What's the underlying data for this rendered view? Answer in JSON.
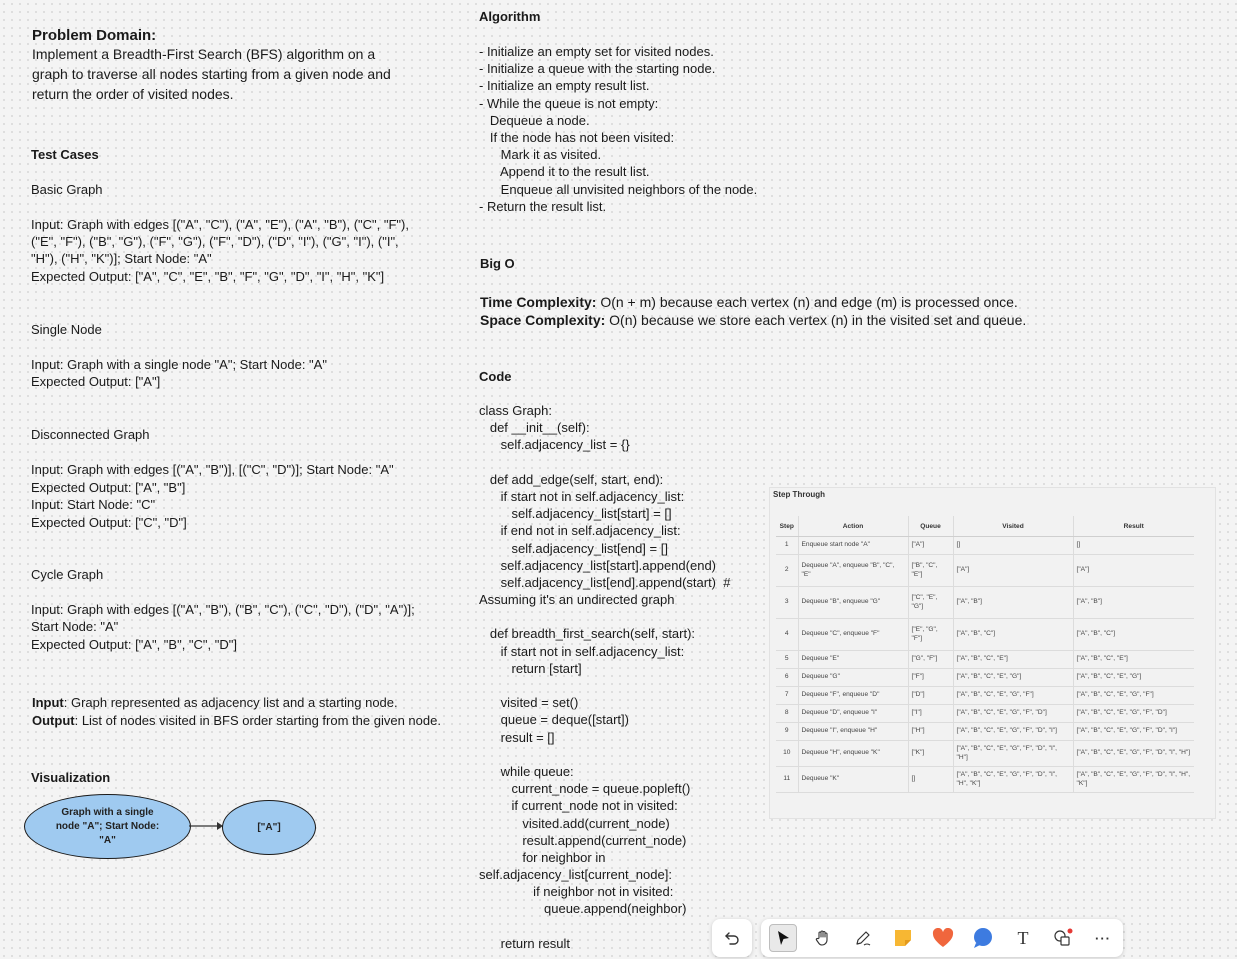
{
  "problem_domain": {
    "heading": "Problem Domain:",
    "text": "Implement a Breadth-First Search (BFS) algorithm on a graph to traverse all nodes starting from a given node and return the order of visited nodes."
  },
  "test_cases": {
    "heading": "Test Cases",
    "basic": {
      "title": "Basic Graph",
      "input": "Input: Graph with edges [(\"A\", \"C\"), (\"A\", \"E\"), (\"A\", \"B\"), (\"C\", \"F\"), (\"E\", \"F\"), (\"B\", \"G\"), (\"F\", \"G\"), (\"F\", \"D\"), (\"D\", \"I\"), (\"G\", \"I\"), (\"I\", \"H\"), (\"H\", \"K\")]; Start Node: \"A\"",
      "output": "Expected Output: [\"A\", \"C\", \"E\", \"B\", \"F\", \"G\", \"D\", \"I\", \"H\", \"K\"]"
    },
    "single": {
      "title": "Single Node",
      "input": "Input: Graph with a single node \"A\"; Start Node: \"A\"",
      "output": "Expected Output: [\"A\"]"
    },
    "disconnected": {
      "title": "Disconnected Graph",
      "input": "Input: Graph with edges [(\"A\", \"B\")], [(\"C\", \"D\")]; Start Node: \"A\"",
      "output": "Expected Output: [\"A\", \"B\"]",
      "input2": "Input: Start Node: \"C\"",
      "output2": "Expected Output: [\"C\", \"D\"]"
    },
    "cycle": {
      "title": "Cycle Graph",
      "input": "Input: Graph with edges [(\"A\", \"B\"), (\"B\", \"C\"), (\"C\", \"D\"), (\"D\", \"A\")]; Start Node: \"A\"",
      "output": "Expected Output: [\"A\", \"B\", \"C\", \"D\"]"
    }
  },
  "io": {
    "input_label": "Input",
    "input_text": ": Graph represented as adjacency list and a starting node.",
    "output_label": "Output",
    "output_text": ": List of nodes visited in BFS order starting from the given node."
  },
  "visualization": {
    "heading": "Visualization",
    "node1": "Graph with a single node \"A\"; Start Node: \"A\"",
    "node2": "[\"A\"]"
  },
  "algorithm": {
    "heading": "Algorithm",
    "lines": [
      "- Initialize an empty set for visited nodes.",
      "- Initialize a queue with the starting node.",
      "- Initialize an empty result list.",
      "- While the queue is not empty:",
      "   Dequeue a node.",
      "   If the node has not been visited:",
      "      Mark it as visited.",
      "      Append it to the result list.",
      "      Enqueue all unvisited neighbors of the node.",
      "- Return the result list."
    ]
  },
  "big_o": {
    "heading": "Big O",
    "time_label": "Time Complexity:",
    "time_text": " O(n + m) because each vertex (n) and edge (m) is processed once.",
    "space_label": "Space Complexity:",
    "space_text": " O(n) because we store each vertex (n) in the visited set and queue."
  },
  "code": {
    "heading": "Code",
    "lines": [
      "class Graph:",
      "   def __init__(self):",
      "      self.adjacency_list = {}",
      "",
      "   def add_edge(self, start, end):",
      "      if start not in self.adjacency_list:",
      "         self.adjacency_list[start] = []",
      "      if end not in self.adjacency_list:",
      "         self.adjacency_list[end] = []",
      "      self.adjacency_list[start].append(end)",
      "      self.adjacency_list[end].append(start)  #",
      "Assuming it's an undirected graph",
      "",
      "   def breadth_first_search(self, start):",
      "      if start not in self.adjacency_list:",
      "         return [start]",
      "",
      "      visited = set()",
      "      queue = deque([start])",
      "      result = []",
      "",
      "      while queue:",
      "         current_node = queue.popleft()",
      "         if current_node not in visited:",
      "            visited.add(current_node)",
      "            result.append(current_node)",
      "            for neighbor in",
      "self.adjacency_list[current_node]:",
      "               if neighbor not in visited:",
      "                  queue.append(neighbor)",
      "",
      "      return result"
    ]
  },
  "step_through": {
    "title": "Step Through",
    "headers": [
      "Step",
      "Action",
      "Queue",
      "Visited",
      "Result"
    ],
    "rows": [
      [
        "1",
        "Enqueue start node \"A\"",
        "[\"A\"]",
        "[]",
        "[]"
      ],
      [
        "2",
        "Dequeue \"A\", enqueue \"B\", \"C\", \"E\"",
        "[\"B\", \"C\", \"E\"]",
        "[\"A\"]",
        "[\"A\"]"
      ],
      [
        "3",
        "Dequeue \"B\", enqueue \"G\"",
        "[\"C\", \"E\", \"G\"]",
        "[\"A\", \"B\"]",
        "[\"A\", \"B\"]"
      ],
      [
        "4",
        "Dequeue \"C\", enqueue \"F\"",
        "[\"E\", \"G\", \"F\"]",
        "[\"A\", \"B\", \"C\"]",
        "[\"A\", \"B\", \"C\"]"
      ],
      [
        "5",
        "Dequeue \"E\"",
        "[\"G\", \"F\"]",
        "[\"A\", \"B\", \"C\", \"E\"]",
        "[\"A\", \"B\", \"C\", \"E\"]"
      ],
      [
        "6",
        "Dequeue \"G\"",
        "[\"F\"]",
        "[\"A\", \"B\", \"C\", \"E\", \"G\"]",
        "[\"A\", \"B\", \"C\", \"E\", \"G\"]"
      ],
      [
        "7",
        "Dequeue \"F\", enqueue \"D\"",
        "[\"D\"]",
        "[\"A\", \"B\", \"C\", \"E\", \"G\", \"F\"]",
        "[\"A\", \"B\", \"C\", \"E\", \"G\", \"F\"]"
      ],
      [
        "8",
        "Dequeue \"D\", enqueue \"I\"",
        "[\"I\"]",
        "[\"A\", \"B\", \"C\", \"E\", \"G\", \"F\", \"D\"]",
        "[\"A\", \"B\", \"C\", \"E\", \"G\", \"F\", \"D\"]"
      ],
      [
        "9",
        "Dequeue \"I\", enqueue \"H\"",
        "[\"H\"]",
        "[\"A\", \"B\", \"C\", \"E\", \"G\", \"F\", \"D\", \"I\"]",
        "[\"A\", \"B\", \"C\", \"E\", \"G\", \"F\", \"D\", \"I\"]"
      ],
      [
        "10",
        "Dequeue \"H\", enqueue \"K\"",
        "[\"K\"]",
        "[\"A\", \"B\", \"C\", \"E\", \"G\", \"F\", \"D\", \"I\", \"H\"]",
        "[\"A\", \"B\", \"C\", \"E\", \"G\", \"F\", \"D\", \"I\", \"H\"]"
      ],
      [
        "11",
        "Dequeue \"K\"",
        "[]",
        "[\"A\", \"B\", \"C\", \"E\", \"G\", \"F\", \"D\", \"I\", \"H\", \"K\"]",
        "[\"A\", \"B\", \"C\", \"E\", \"G\", \"F\", \"D\", \"I\", \"H\", \"K\"]"
      ]
    ]
  },
  "toolbar": {
    "undo_icon": "undo-icon",
    "tools": [
      "select-cursor-icon",
      "hand-icon",
      "pen-icon",
      "sticky-note-icon",
      "heart-icon",
      "chat-bubble-icon",
      "text-icon",
      "shapes-icon",
      "more-icon"
    ],
    "text_tool_glyph": "T",
    "more_glyph": "···"
  },
  "colors": {
    "ellipse_fill": "#9fcaf0",
    "sticky_note": "#f7b733",
    "heart": "#f0663d",
    "chat_bubble": "#3d7be0",
    "notification_dot": "#e53935"
  }
}
